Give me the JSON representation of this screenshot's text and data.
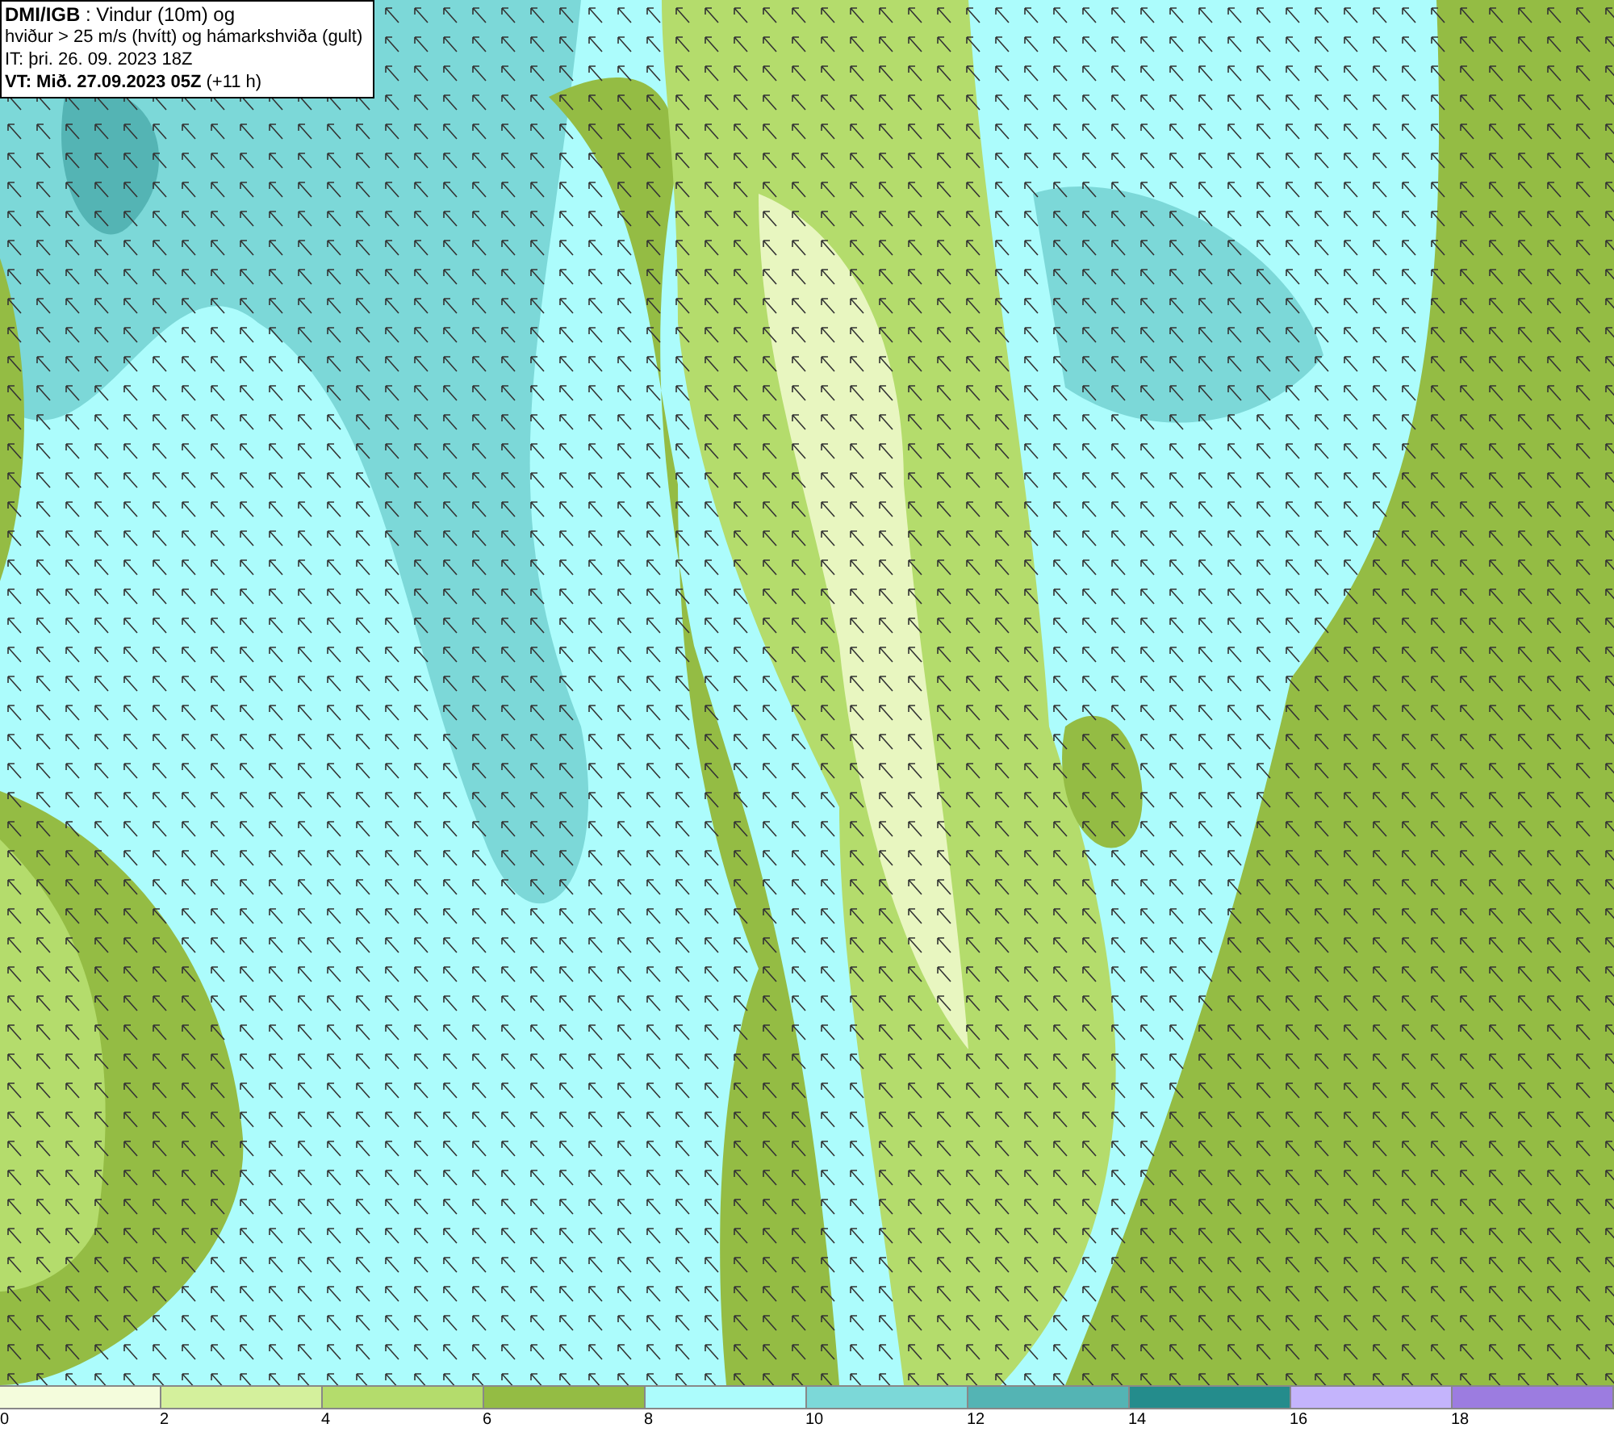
{
  "header": {
    "lines": [
      "**DMI/IGB** : Vindur (10m) og",
      "hviður > 25 m/s (hvítt) og hámarkshviða (gult)",
      "IT: þri. 26. 09. 2023 18Z",
      "**VT: Mið. 27.09.2023 05Z** (+11 h)"
    ]
  },
  "legend": {
    "bins": [
      {
        "color": "#f4fcdc",
        "label": "0"
      },
      {
        "color": "#d4f09c",
        "label": "2"
      },
      {
        "color": "#b4dc6c",
        "label": "4"
      },
      {
        "color": "#94bc44",
        "label": "6"
      },
      {
        "color": "#acfcfc",
        "label": "8"
      },
      {
        "color": "#7cd8d8",
        "label": "10"
      },
      {
        "color": "#54b4b4",
        "label": "12"
      },
      {
        "color": "#248c8c",
        "label": "14"
      },
      {
        "color": "#c4b4fc",
        "label": "16"
      },
      {
        "color": "#9c7ce0",
        "label": "18"
      }
    ]
  }
}
